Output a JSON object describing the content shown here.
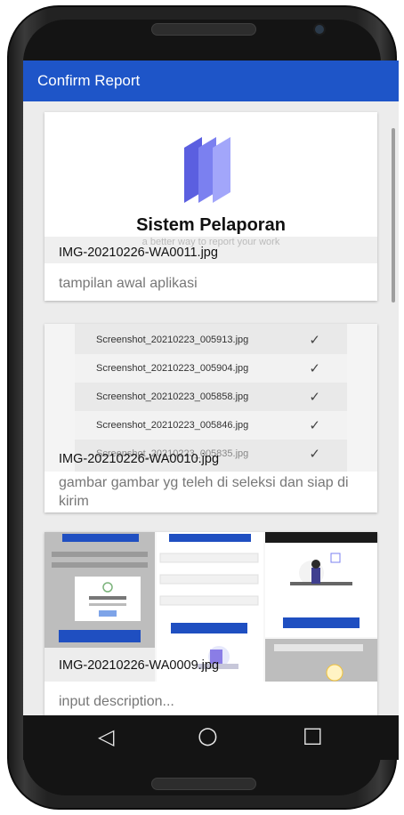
{
  "app_bar": {
    "title": "Confirm Report"
  },
  "reports": [
    {
      "file_name": "IMG-20210226-WA0011.jpg",
      "description": "tampilan awal aplikasi",
      "preview": {
        "title": "Sistem Pelaporan",
        "subtitle": "a better way to report your work"
      }
    },
    {
      "file_name": "IMG-20210226-WA0010.jpg",
      "description": "gambar gambar yg teleh di seleksi dan siap di kirim",
      "preview": {
        "files": [
          {
            "name": "Screenshot_20210223_005913.jpg",
            "mark": "✓"
          },
          {
            "name": "Screenshot_20210223_005904.jpg",
            "mark": "✓"
          },
          {
            "name": "Screenshot_20210223_005858.jpg",
            "mark": "✓"
          },
          {
            "name": "Screenshot_20210223_005846.jpg",
            "mark": "✓"
          },
          {
            "name": "Screenshot_20210223_005835.jpg",
            "mark": "✓"
          }
        ]
      }
    },
    {
      "file_name": "IMG-20210226-WA0009.jpg",
      "description_placeholder": "input description..."
    }
  ],
  "nav": {
    "back": "◁",
    "home": "○",
    "recents": "□"
  },
  "colors": {
    "app_bar": "#1e55c8",
    "screen_bg": "#ececec"
  }
}
